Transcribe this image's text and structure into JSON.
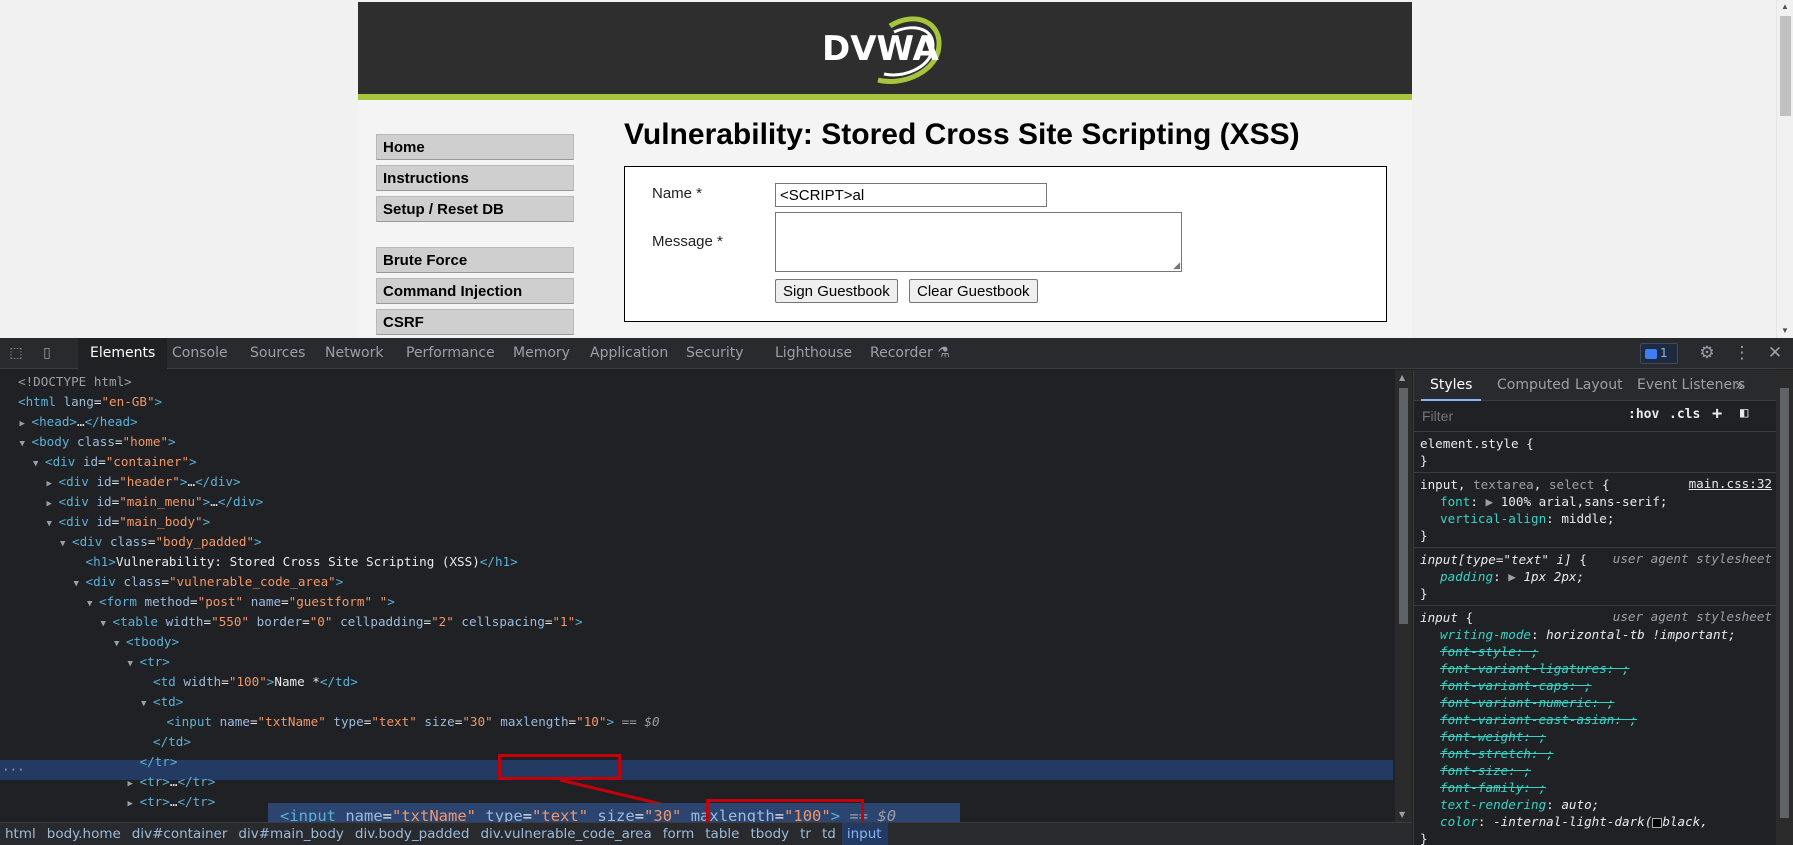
{
  "page": {
    "logo_text": "DVWA",
    "title": "Vulnerability: Stored Cross Site Scripting (XSS)",
    "menu": [
      "Home",
      "Instructions",
      "Setup / Reset DB",
      "Brute Force",
      "Command Injection",
      "CSRF"
    ],
    "form": {
      "name_label": "Name *",
      "name_value": "<SCRIPT>al",
      "message_label": "Message *",
      "sign_button": "Sign Guestbook",
      "clear_button": "Clear Guestbook"
    }
  },
  "devtools": {
    "tabs": [
      "Elements",
      "Console",
      "Sources",
      "Network",
      "Performance",
      "Memory",
      "Application",
      "Security",
      "Lighthouse",
      "Recorder"
    ],
    "active_tab": "Elements",
    "issues_count": "1",
    "dom_lines": [
      {
        "indent": 0,
        "tri": "",
        "html": "<span class='gr'>&lt;!DOCTYPE html&gt;</span>"
      },
      {
        "indent": 0,
        "tri": "",
        "html": "<span class='tg'>&lt;html</span> <span class='an'>lang</span>=<span class='av'>\"en-GB\"</span><span class='tg'>&gt;</span>"
      },
      {
        "indent": 1,
        "tri": "▶",
        "html": "<span class='tg'>&lt;head&gt;</span>…<span class='tg'>&lt;/head&gt;</span>"
      },
      {
        "indent": 1,
        "tri": "▼",
        "html": "<span class='tg'>&lt;body</span> <span class='an'>class</span>=<span class='av'>\"home\"</span><span class='tg'>&gt;</span>"
      },
      {
        "indent": 2,
        "tri": "▼",
        "html": "<span class='tg'>&lt;div</span> <span class='an'>id</span>=<span class='av'>\"container\"</span><span class='tg'>&gt;</span>"
      },
      {
        "indent": 3,
        "tri": "▶",
        "html": "<span class='tg'>&lt;div</span> <span class='an'>id</span>=<span class='av'>\"header\"</span><span class='tg'>&gt;</span>…<span class='tg'>&lt;/div&gt;</span>"
      },
      {
        "indent": 3,
        "tri": "▶",
        "html": "<span class='tg'>&lt;div</span> <span class='an'>id</span>=<span class='av'>\"main_menu\"</span><span class='tg'>&gt;</span>…<span class='tg'>&lt;/div&gt;</span>"
      },
      {
        "indent": 3,
        "tri": "▼",
        "html": "<span class='tg'>&lt;div</span> <span class='an'>id</span>=<span class='av'>\"main_body\"</span><span class='tg'>&gt;</span>"
      },
      {
        "indent": 4,
        "tri": "▼",
        "html": "<span class='tg'>&lt;div</span> <span class='an'>class</span>=<span class='av'>\"body_padded\"</span><span class='tg'>&gt;</span>"
      },
      {
        "indent": 5,
        "tri": "",
        "html": "<span class='tg'>&lt;h1&gt;</span>Vulnerability: Stored Cross Site Scripting (XSS)<span class='tg'>&lt;/h1&gt;</span>"
      },
      {
        "indent": 5,
        "tri": "▼",
        "html": "<span class='tg'>&lt;div</span> <span class='an'>class</span>=<span class='av'>\"vulnerable_code_area\"</span><span class='tg'>&gt;</span>"
      },
      {
        "indent": 6,
        "tri": "▼",
        "html": "<span class='tg'>&lt;form</span> <span class='an'>method</span>=<span class='av'>\"post\"</span> <span class='an'>name</span>=<span class='av'>\"guestform\"</span> <span class='av'>\"</span><span class='tg'>&gt;</span>"
      },
      {
        "indent": 7,
        "tri": "▼",
        "html": "<span class='tg'>&lt;table</span> <span class='an'>width</span>=<span class='av'>\"550\"</span> <span class='an'>border</span>=<span class='av'>\"0\"</span> <span class='an'>cellpadding</span>=<span class='av'>\"2\"</span> <span class='an'>cellspacing</span>=<span class='av'>\"1\"</span><span class='tg'>&gt;</span>"
      },
      {
        "indent": 8,
        "tri": "▼",
        "html": "<span class='tg'>&lt;tbody&gt;</span>"
      },
      {
        "indent": 9,
        "tri": "▼",
        "html": "<span class='tg'>&lt;tr&gt;</span>"
      },
      {
        "indent": 10,
        "tri": "",
        "html": "<span class='tg'>&lt;td</span> <span class='an'>width</span>=<span class='av'>\"100\"</span><span class='tg'>&gt;</span>Name *<span class='tg'>&lt;/td&gt;</span>"
      },
      {
        "indent": 10,
        "tri": "▼",
        "html": "<span class='tg'>&lt;td&gt;</span>"
      },
      {
        "indent": 11,
        "tri": "",
        "html": "<span class='tg'>&lt;input</span> <span class='an'>name</span>=<span class='av'>\"txtName\"</span> <span class='an'>type</span>=<span class='av'>\"text\"</span> <span class='an'>size</span>=<span class='av'>\"30\"</span> <span class='an'>maxlength</span>=<span class='av'>\"10\"</span><span class='tg'>&gt;</span> <span class='gr'>== </span><span class='gr' style='font-style:italic'>$0</span>"
      },
      {
        "indent": 10,
        "tri": "",
        "html": "<span class='tg'>&lt;/td&gt;</span>"
      },
      {
        "indent": 9,
        "tri": "",
        "html": "<span class='tg'>&lt;/tr&gt;</span>"
      },
      {
        "indent": 9,
        "tri": "▶",
        "html": "<span class='tg'>&lt;tr&gt;</span>…<span class='tg'>&lt;/tr&gt;</span>"
      },
      {
        "indent": 9,
        "tri": "▶",
        "html": "<span class='tg'>&lt;tr&gt;</span>…<span class='tg'>&lt;/tr&gt;</span>"
      }
    ],
    "overlay_html": "<span class='tg'>&lt;input</span> <span class='an'>name</span>=<span class='av'>\"txtName\"</span> <span class='an'>type</span>=<span class='av'>\"text\"</span> <span class='an'>size</span>=<span class='av'>\"30\"</span> <span class='an'>maxlength</span>=<span class='av'>\"100\"</span><span class='tg'>&gt;</span> <span class='gr' style='font-style:italic'>== $0</span>",
    "breadcrumbs": [
      "html",
      "body.home",
      "div#container",
      "div#main_body",
      "div.body_padded",
      "div.vulnerable_code_area",
      "form",
      "table",
      "tbody",
      "tr",
      "td",
      "input"
    ],
    "styles": {
      "tabs": [
        "Styles",
        "Computed",
        "Layout",
        "Event Listeners"
      ],
      "filter_placeholder": "Filter",
      "hov": ":hov",
      "cls": ".cls",
      "rules": [
        {
          "selector_html": "<span class='sel'>element.style</span> {",
          "lines": [],
          "source": "",
          "ua": ""
        },
        {
          "selector_html": "<span class='sel'>input</span>, <span class='sel-dim'>textarea</span>, <span class='sel-dim'>select</span> {",
          "source": "main.css:32",
          "ua": "",
          "lines": [
            "<span class='pn'>font</span>: <span class='gr'>▶</span> <span class='pv'>100% arial,sans-serif;</span>",
            "<span class='pn'>vertical-align</span>: <span class='pv'>middle;</span>"
          ]
        },
        {
          "selector_html": "<span class='sel' style='font-style:italic'>input[type=\"text\" i]</span> {",
          "source": "",
          "ua": "user agent stylesheet",
          "lines": [
            "<span class='pn' style='font-style:italic'>padding</span>: <span class='gr'>▶</span> <span class='pv' style='font-style:italic'>1px 2px;</span>"
          ]
        },
        {
          "selector_html": "<span class='sel' style='font-style:italic'>input</span> {",
          "source": "",
          "ua": "user agent stylesheet",
          "lines": [
            "<span class='pn' style='font-style:italic'>writing-mode</span>: <span class='pv' style='font-style:italic'>horizontal-tb !important;</span>",
            "<span class='strike'>font-style: ;</span>",
            "<span class='strike'>font-variant-ligatures: ;</span>",
            "<span class='strike'>font-variant-caps: ;</span>",
            "<span class='strike'>font-variant-numeric: ;</span>",
            "<span class='strike'>font-variant-east-asian: ;</span>",
            "<span class='strike'>font-weight: ;</span>",
            "<span class='strike'>font-stretch: ;</span>",
            "<span class='strike'>font-size: ;</span>",
            "<span class='strike'>font-family: ;</span>",
            "<span class='pn' style='font-style:italic'>text-rendering</span>: <span class='pv' style='font-style:italic'>auto;</span>",
            "<span class='pn' style='font-style:italic'>color</span>: <span class='pv' style='font-style:italic'>-internal-light-dark(<span style='display:inline-block;width:10px;height:10px;border:1px solid #aaa;background:#000;vertical-align:middle'></span>black,</span>"
          ]
        }
      ]
    }
  }
}
